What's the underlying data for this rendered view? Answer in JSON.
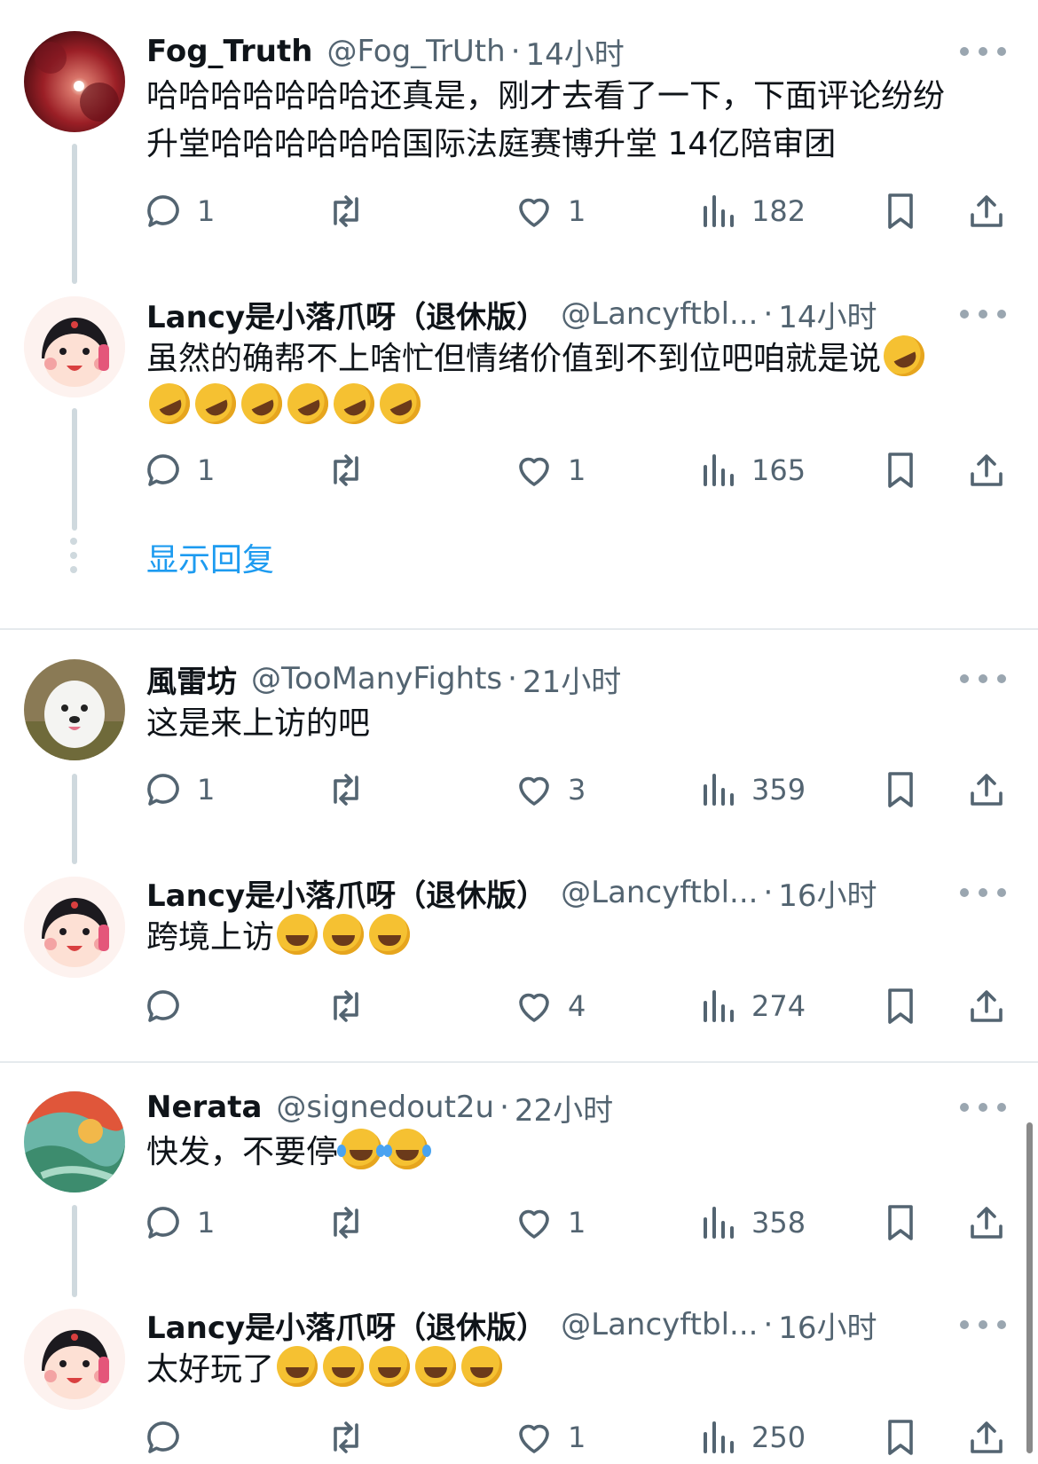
{
  "replies": [
    {
      "name": "Fog_Truth",
      "handle": "@Fog_TrUth",
      "time": "14小时",
      "line1": "哈哈哈哈哈哈哈还真是，刚才去看了一下，下面评论纷纷",
      "line2": "升堂哈哈哈哈哈哈国际法庭赛博升堂 14亿陪审团",
      "replies": "1",
      "retweets": "",
      "likes": "1",
      "views": "182",
      "avatar": "red-autumn-tree"
    },
    {
      "name": "Lancy是小落爪呀（退休版）",
      "handle": "@Lancyftbl...",
      "time": "14小时",
      "line1": "虽然的确帮不上啥忙但情绪价值到不到位吧咱就是说",
      "replies": "1",
      "retweets": "",
      "likes": "1",
      "views": "165",
      "avatar": "cartoon-girl"
    },
    {
      "name": "風雷坊",
      "handle": "@TooManyFights",
      "time": "21小时",
      "line1": "这是来上访的吧",
      "replies": "1",
      "retweets": "",
      "likes": "3",
      "views": "359",
      "avatar": "white-dog"
    },
    {
      "name": "Lancy是小落爪呀（退休版）",
      "handle": "@Lancyftbl...",
      "time": "16小时",
      "line1": "跨境上访",
      "replies": "",
      "retweets": "",
      "likes": "4",
      "views": "274",
      "avatar": "cartoon-girl"
    },
    {
      "name": "Nerata",
      "handle": "@signedout2u",
      "time": "22小时",
      "line1": "快发，不要停",
      "replies": "1",
      "retweets": "",
      "likes": "1",
      "views": "358",
      "avatar": "colorful-painting"
    },
    {
      "name": "Lancy是小落爪呀（退休版）",
      "handle": "@Lancyftbl...",
      "time": "16小时",
      "line1": "太好玩了",
      "replies": "",
      "retweets": "",
      "likes": "1",
      "views": "250",
      "avatar": "cartoon-girl"
    }
  ],
  "show_replies": "显示回复",
  "dot": "·",
  "colors": {
    "link": "#1d9bf0",
    "muted": "#536471",
    "text": "#0f1419",
    "thread_line": "#cfd9de"
  }
}
